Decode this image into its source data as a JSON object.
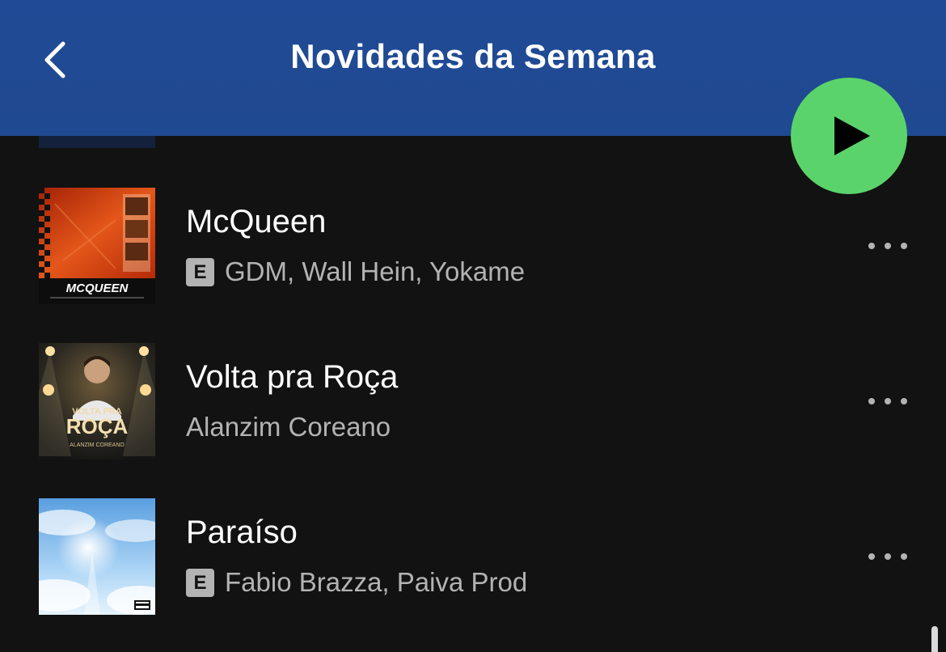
{
  "header": {
    "title": "Novidades da Semana",
    "back_icon": "chevron-left-icon",
    "background": "#214a96"
  },
  "play_button": {
    "icon": "play-icon",
    "color": "#5bd36b"
  },
  "tracks": [
    {
      "title": "McQueen",
      "explicit": true,
      "explicit_label": "E",
      "artists": "GDM, Wall Hein, Yokame",
      "art_logo": "MCQUEEN",
      "more_icon": "more-options-icon"
    },
    {
      "title": "Volta pra Roça",
      "explicit": false,
      "explicit_label": "",
      "artists": "Alanzim Coreano",
      "art_line1": "VOLTA PRA",
      "art_line2": "ROÇA",
      "art_line3": "ALANZIM COREANO",
      "more_icon": "more-options-icon"
    },
    {
      "title": "Paraíso",
      "explicit": true,
      "explicit_label": "E",
      "artists": "Fabio Brazza, Paiva Prod",
      "more_icon": "more-options-icon"
    }
  ],
  "colors": {
    "background": "#121212",
    "text_primary": "#ffffff",
    "text_secondary": "#b3b3b3",
    "accent": "#5bd36b"
  }
}
